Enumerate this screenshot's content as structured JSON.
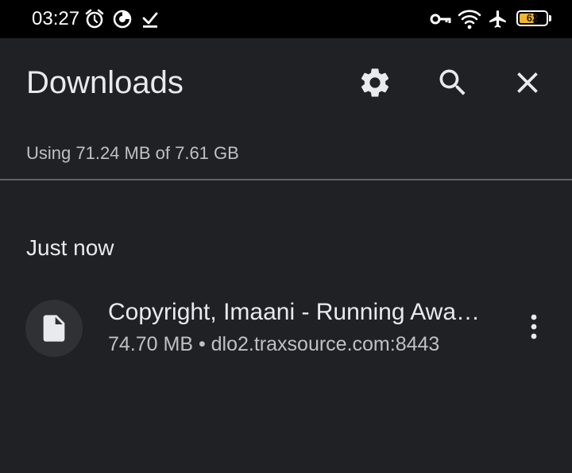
{
  "status_bar": {
    "time": "03:27",
    "battery": "62",
    "battery_level": 0.62,
    "icons": [
      "alarm-icon",
      "data-saver-icon",
      "download-done-icon",
      "vpn-key-icon",
      "wifi-icon",
      "airplane-icon",
      "battery-icon"
    ]
  },
  "toolbar": {
    "title": "Downloads",
    "icons": [
      "settings-icon",
      "search-icon",
      "close-icon"
    ]
  },
  "storage": {
    "usage_text": "Using 71.24 MB of 7.61 GB"
  },
  "sections": [
    {
      "label": "Just now",
      "items": [
        {
          "title": "Copyright, Imaani - Running Awa…",
          "meta": "74.70 MB • dlo2.traxsource.com:8443",
          "icon": "file-icon",
          "menu_icon": "more-vert-icon"
        }
      ]
    }
  ]
}
